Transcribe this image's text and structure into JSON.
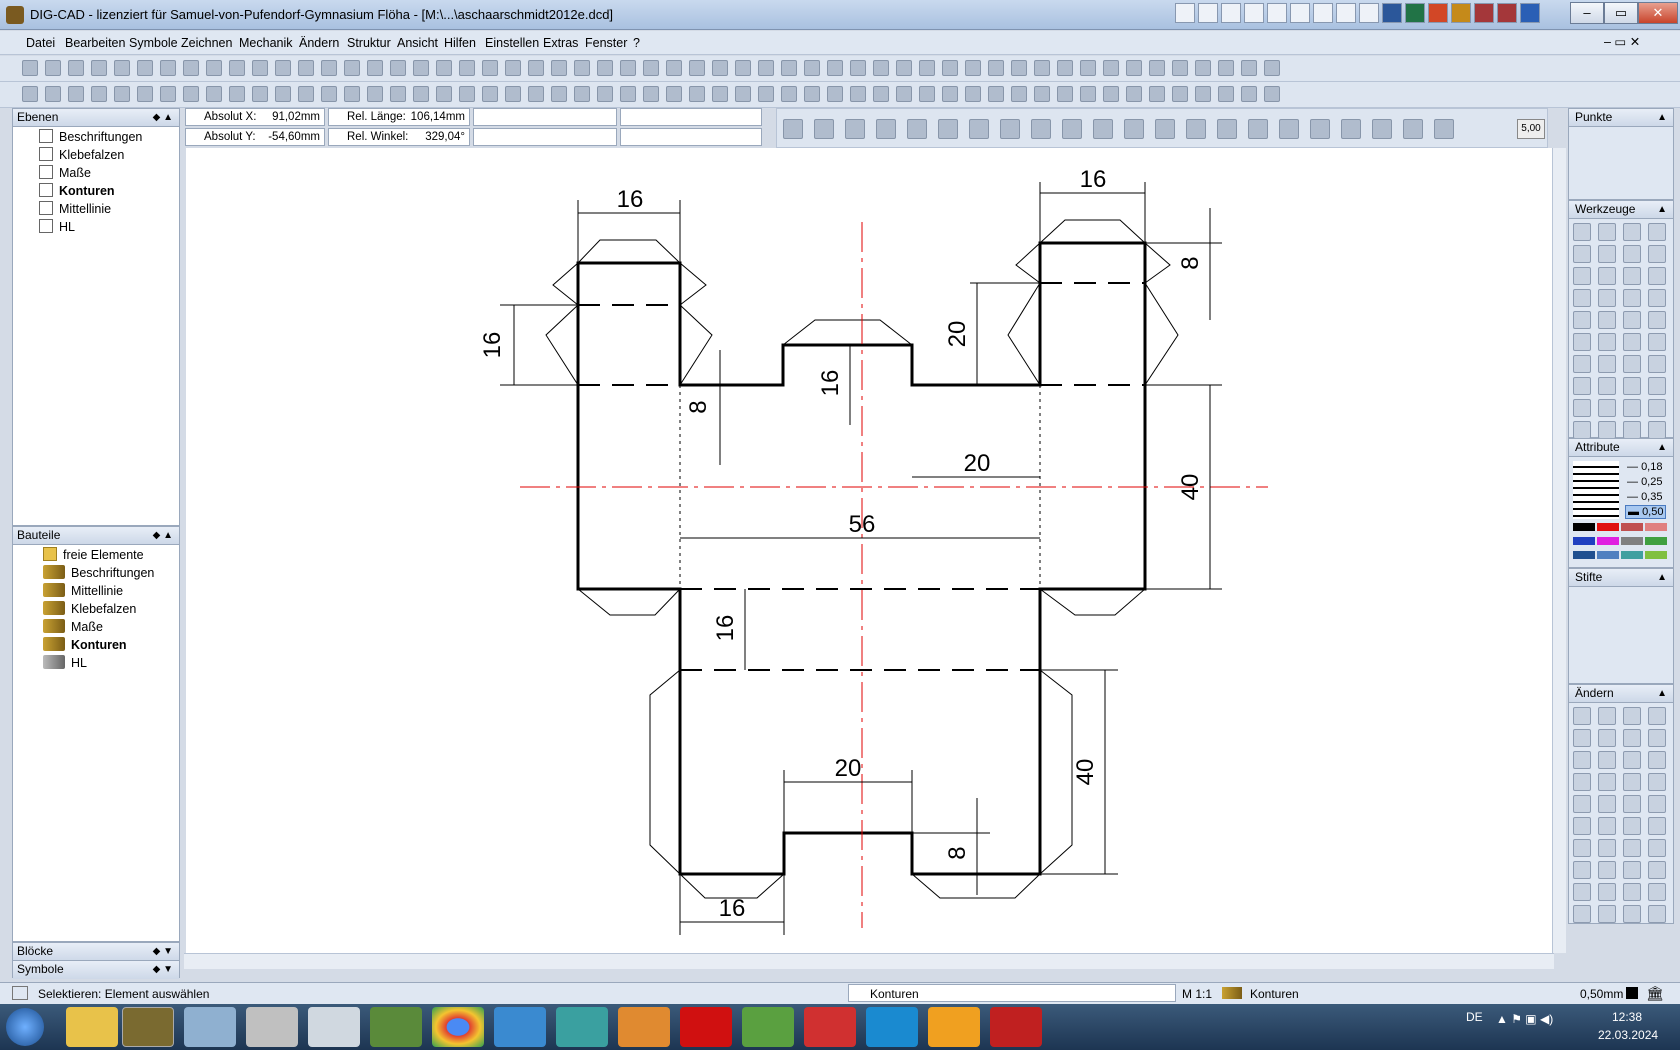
{
  "window": {
    "title": "DIG-CAD - lizenziert für Samuel-von-Pufendorf-Gymnasium Flöha - [M:\\...\\aschaarschmidt2012e.dcd]",
    "min": "–",
    "max": "▭",
    "close": "✕"
  },
  "menu": [
    "Datei",
    "Bearbeiten",
    "Symbole",
    "Zeichnen",
    "Mechanik",
    "Ändern",
    "Struktur",
    "Ansicht",
    "Hilfen",
    "Einstellen",
    "Extras",
    "Fenster",
    "?"
  ],
  "coords": {
    "abs_x_label": "Absolut X:",
    "abs_x_value": "91,02mm",
    "abs_y_label": "Absolut Y:",
    "abs_y_value": "-54,60mm",
    "rel_len_label": "Rel. Länge:",
    "rel_len_value": "106,14mm",
    "rel_angle_label": "Rel. Winkel:",
    "rel_angle_value": "329,04°",
    "zoom_value": "5,00"
  },
  "ebenen": {
    "title": "Ebenen",
    "items": [
      "Beschriftungen",
      "Klebefalzen",
      "Maße",
      "Konturen",
      "Mittellinie",
      "HL"
    ]
  },
  "bauteile": {
    "title": "Bauteile",
    "items": [
      "freie Elemente",
      "Beschriftungen",
      "Mittellinie",
      "Klebefalzen",
      "Maße",
      "Konturen",
      "HL"
    ]
  },
  "bottom_panels": [
    "Blöcke",
    "Symbole"
  ],
  "right_panels": {
    "punkte": "Punkte",
    "werkzeuge": "Werkzeuge",
    "attribute": "Attribute",
    "stifte": "Stifte",
    "aendern": "Ändern",
    "line_widths": [
      "0,18",
      "0,25",
      "0,35",
      "0,50"
    ],
    "palette": [
      "#000000",
      "#e01010",
      "#c05050",
      "#e08080",
      "#2040c0",
      "#e020e0",
      "#808080",
      "#40a040",
      "#205090",
      "#5080c0",
      "#40a0a0",
      "#80c040"
    ]
  },
  "drawing": {
    "dims": [
      "16",
      "16",
      "16",
      "8",
      "20",
      "16",
      "8",
      "20",
      "40",
      "56",
      "16",
      "40",
      "20",
      "8",
      "16"
    ]
  },
  "status": {
    "message": "Selektieren: Element auswählen",
    "layer": "Konturen",
    "scale": "M 1:1",
    "part": "Konturen",
    "pen": "0,50mm"
  },
  "taskbar": {
    "lang": "DE",
    "time": "12:38",
    "date": "22.03.2024"
  }
}
